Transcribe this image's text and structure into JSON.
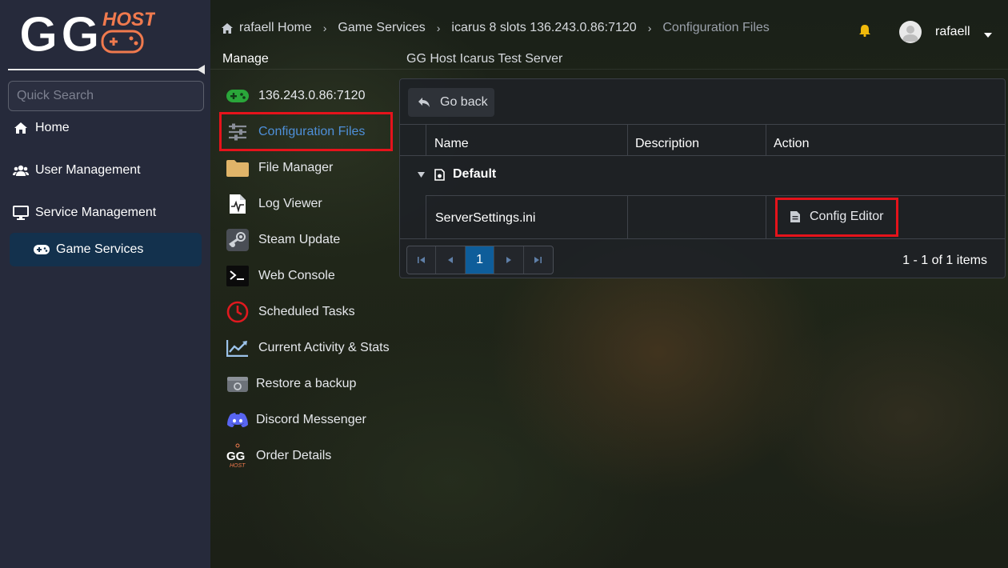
{
  "sidebar": {
    "logo_letters": "GG",
    "logo_word": "HOST",
    "search_placeholder": "Quick Search",
    "items": [
      {
        "label": "Home",
        "icon": "home-icon"
      },
      {
        "label": "User Management",
        "icon": "users-icon"
      },
      {
        "label": "Service Management",
        "icon": "monitor-icon"
      }
    ],
    "sub_item": {
      "label": "Game Services",
      "icon": "gamepad-icon"
    }
  },
  "breadcrumb": {
    "items": [
      "rafaell Home",
      "Game Services",
      "icarus 8 slots 136.243.0.86:7120",
      "Configuration Files"
    ],
    "separator": "›"
  },
  "user": {
    "name": "rafaell"
  },
  "manage": {
    "title": "Manage",
    "server_name": "GG Host Icarus Test Server",
    "items": [
      {
        "label": "136.243.0.86:7120",
        "icon": "green-gamepad-icon"
      },
      {
        "label": "Configuration Files",
        "icon": "sliders-icon",
        "active": true
      },
      {
        "label": "File Manager",
        "icon": "folder-icon"
      },
      {
        "label": "Log Viewer",
        "icon": "log-file-icon"
      },
      {
        "label": "Steam Update",
        "icon": "steam-icon"
      },
      {
        "label": "Web Console",
        "icon": "terminal-icon"
      },
      {
        "label": "Scheduled Tasks",
        "icon": "clock-icon"
      },
      {
        "label": "Current Activity & Stats",
        "icon": "chart-icon"
      },
      {
        "label": "Restore a backup",
        "icon": "backup-drive-icon"
      },
      {
        "label": "Discord Messenger",
        "icon": "discord-icon"
      },
      {
        "label": "Order Details",
        "icon": "gghost-logo-icon"
      }
    ]
  },
  "panel": {
    "go_back": "Go back",
    "columns": [
      "Name",
      "Description",
      "Action"
    ],
    "group": "Default",
    "rows": [
      {
        "name": "ServerSettings.ini",
        "description": "",
        "action": "Config Editor"
      }
    ],
    "pager": {
      "current_page": "1",
      "info": "1 - 1 of 1 items"
    }
  },
  "colors": {
    "sidebar_bg": "#262a3b",
    "active_link": "#4e8fd8",
    "highlight": "#e5131b",
    "pager_active": "#0e5d9a",
    "logo_accent": "#f07a4e"
  }
}
